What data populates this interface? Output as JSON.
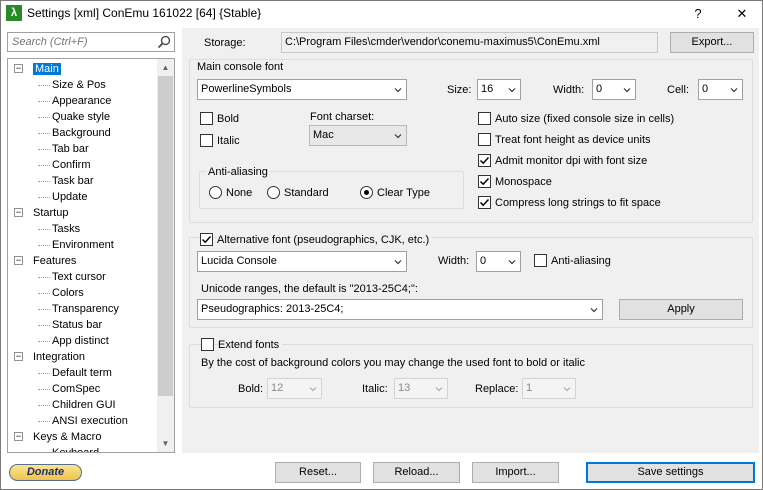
{
  "window": {
    "title": "Settings [xml] ConEmu 161022 [64] {Stable}",
    "help_glyph": "?",
    "close_glyph": "✕",
    "app_icon_glyph": "λ"
  },
  "sidebar": {
    "search_placeholder": "Search (Ctrl+F)",
    "tree": [
      {
        "label": "Main",
        "level": 0,
        "expander": "−",
        "selected": true
      },
      {
        "label": "Size & Pos",
        "level": 1
      },
      {
        "label": "Appearance",
        "level": 1
      },
      {
        "label": "Quake style",
        "level": 1
      },
      {
        "label": "Background",
        "level": 1
      },
      {
        "label": "Tab bar",
        "level": 1
      },
      {
        "label": "Confirm",
        "level": 1
      },
      {
        "label": "Task bar",
        "level": 1
      },
      {
        "label": "Update",
        "level": 1
      },
      {
        "label": "Startup",
        "level": 0,
        "expander": "−"
      },
      {
        "label": "Tasks",
        "level": 1
      },
      {
        "label": "Environment",
        "level": 1
      },
      {
        "label": "Features",
        "level": 0,
        "expander": "−"
      },
      {
        "label": "Text cursor",
        "level": 1
      },
      {
        "label": "Colors",
        "level": 1
      },
      {
        "label": "Transparency",
        "level": 1
      },
      {
        "label": "Status bar",
        "level": 1
      },
      {
        "label": "App distinct",
        "level": 1
      },
      {
        "label": "Integration",
        "level": 0,
        "expander": "−"
      },
      {
        "label": "Default term",
        "level": 1
      },
      {
        "label": "ComSpec",
        "level": 1
      },
      {
        "label": "Children GUI",
        "level": 1
      },
      {
        "label": "ANSI execution",
        "level": 1
      },
      {
        "label": "Keys & Macro",
        "level": 0,
        "expander": "−"
      },
      {
        "label": "Keyboard",
        "level": 1
      }
    ]
  },
  "storage": {
    "label": "Storage:",
    "path": "C:\\Program Files\\cmder\\vendor\\conemu-maximus5\\ConEmu.xml",
    "export_label": "Export..."
  },
  "main_font": {
    "group_label": "Main console font",
    "font_name": "PowerlineSymbols",
    "size_label": "Size:",
    "size_value": "16",
    "width_label": "Width:",
    "width_value": "0",
    "cell_label": "Cell:",
    "cell_value": "0",
    "bold_label": "Bold",
    "bold_checked": false,
    "italic_label": "Italic",
    "italic_checked": false,
    "charset_label": "Font charset:",
    "charset_value": "Mac",
    "antialiasing_label": "Anti-aliasing",
    "aa_options": [
      {
        "label": "None",
        "selected": false
      },
      {
        "label": "Standard",
        "selected": false
      },
      {
        "label": "Clear Type",
        "selected": true
      }
    ],
    "options": [
      {
        "label": "Auto size (fixed console size in cells)",
        "checked": false
      },
      {
        "label": "Treat font height as device units",
        "checked": false
      },
      {
        "label": "Admit monitor dpi with font size",
        "checked": true
      },
      {
        "label": "Monospace",
        "checked": true
      },
      {
        "label": "Compress long strings to fit space",
        "checked": true
      }
    ]
  },
  "alt_font": {
    "enabled_label": "Alternative font (pseudographics, CJK, etc.)",
    "enabled_checked": true,
    "font_name": "Lucida Console",
    "width_label": "Width:",
    "width_value": "0",
    "antialiasing_label": "Anti-aliasing",
    "antialiasing_checked": false,
    "unicode_label": "Unicode ranges, the default is \"2013-25C4;\":",
    "unicode_value": "Pseudographics: 2013-25C4;",
    "apply_label": "Apply"
  },
  "extend_fonts": {
    "label": "Extend fonts",
    "checked": false,
    "description": "By the cost of background colors you may change the used font to bold or italic",
    "bold_label": "Bold:",
    "bold_value": "12",
    "italic_label": "Italic:",
    "italic_value": "13",
    "replace_label": "Replace:",
    "replace_value": "1"
  },
  "footer": {
    "donate_label": "Donate",
    "reset_label": "Reset...",
    "reload_label": "Reload...",
    "import_label": "Import...",
    "save_label": "Save settings"
  }
}
